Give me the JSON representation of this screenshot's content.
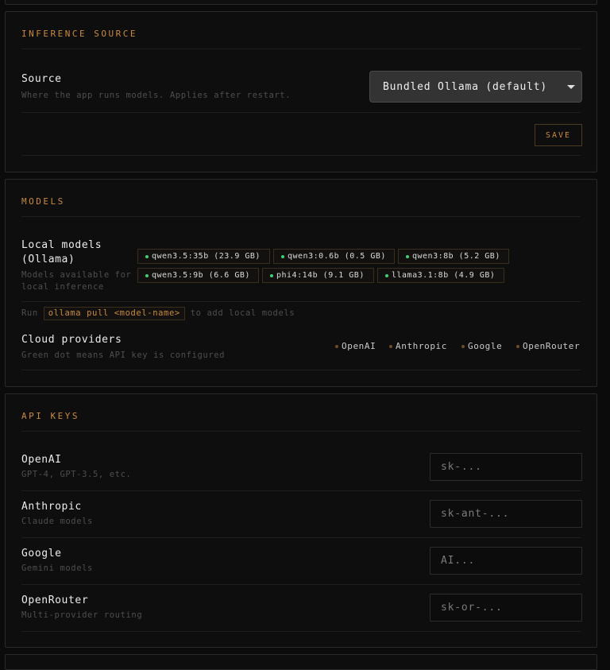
{
  "inference": {
    "section_title": "INFERENCE SOURCE",
    "source_label": "Source",
    "source_hint": "Where the app runs models. Applies after restart.",
    "source_value": "Bundled Ollama (default)",
    "save_label": "SAVE"
  },
  "models": {
    "section_title": "MODELS",
    "local_label_line1": "Local models",
    "local_label_line2": "(Ollama)",
    "local_hint_line1": "Models available for",
    "local_hint_line2": "local inference",
    "chips": [
      {
        "label": "qwen3.5:35b (23.9 GB)"
      },
      {
        "label": "qwen3:0.6b (0.5 GB)"
      },
      {
        "label": "qwen3:8b (5.2 GB)"
      },
      {
        "label": "qwen3.5:9b (6.6 GB)"
      },
      {
        "label": "phi4:14b (9.1 GB)"
      },
      {
        "label": "llama3.1:8b (4.9 GB)"
      }
    ],
    "run_prefix": "Run",
    "run_command": "ollama pull <model-name>",
    "run_suffix": "to add local models",
    "cloud_label": "Cloud providers",
    "cloud_hint": "Green dot means API key is configured",
    "providers": [
      {
        "name": "OpenAI",
        "configured": false
      },
      {
        "name": "Anthropic",
        "configured": false
      },
      {
        "name": "Google",
        "configured": false
      },
      {
        "name": "OpenRouter",
        "configured": false
      }
    ]
  },
  "api_keys": {
    "section_title": "API KEYS",
    "rows": [
      {
        "label": "OpenAI",
        "hint": "GPT-4, GPT-3.5, etc.",
        "value": "",
        "placeholder": "sk-..."
      },
      {
        "label": "Anthropic",
        "hint": "Claude models",
        "value": "",
        "placeholder": "sk-ant-..."
      },
      {
        "label": "Google",
        "hint": "Gemini models",
        "value": "",
        "placeholder": "AI..."
      },
      {
        "label": "OpenRouter",
        "hint": "Multi-provider routing",
        "value": "",
        "placeholder": "sk-or-..."
      }
    ]
  },
  "colors": {
    "accent": "#c98a3c",
    "green_dot": "#3ed16f",
    "off_dot": "#6b4c28"
  }
}
